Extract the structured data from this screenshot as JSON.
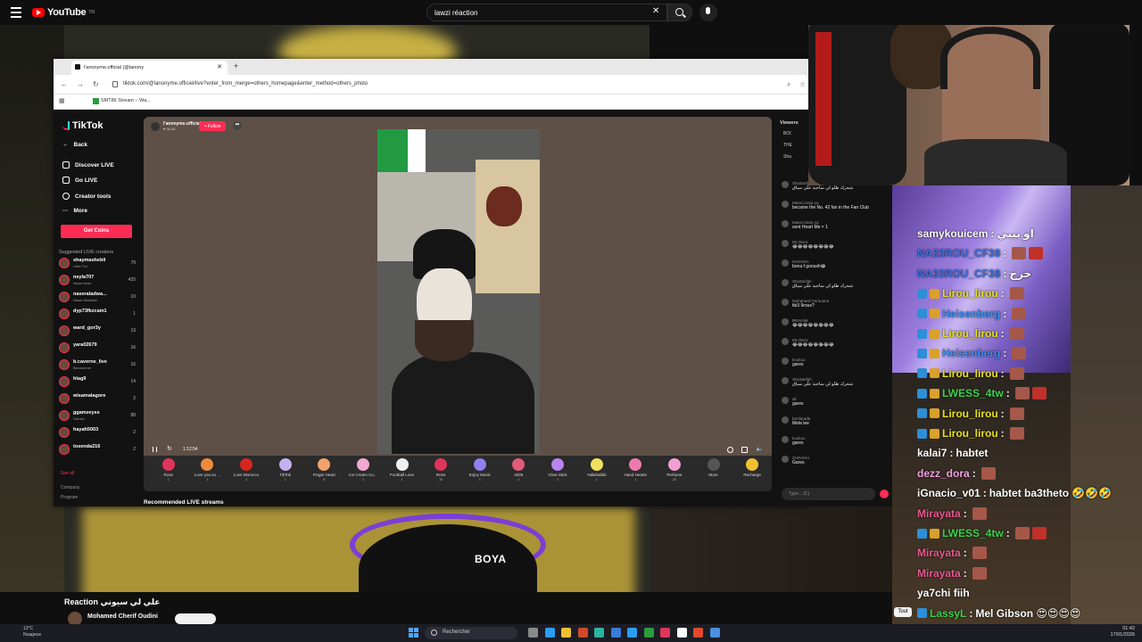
{
  "youtube": {
    "logo_text": "YouTube",
    "logo_sup": "TN",
    "search_value": "lawzi réaction",
    "video_title": "Reaction علي لي سيوني",
    "channel_name": "Mohamed Cherif Oudini",
    "tout_label": "Tout"
  },
  "browser": {
    "tab_title": "l'anonyme.official (@lanony",
    "url": "tiktok.com/@lanonyme.officiel/live?enter_from_merge=others_homepage&enter_method=others_photo",
    "bookmark": "SMT86 Stream – Wa..."
  },
  "tiktok": {
    "logo": "TikTok",
    "nav": {
      "back": "Back",
      "discover": "Discover LIVE",
      "golive": "Go LIVE",
      "creator": "Creator tools",
      "more": "More"
    },
    "get_coins": "Get Coins",
    "suggested_title": "Suggested LIVE creators",
    "creators": [
      {
        "name": "shaymashebil",
        "sub": "Little Fox",
        "count": "79"
      },
      {
        "name": "neyla707",
        "sub": "Neyla Asmr",
        "count": "425"
      },
      {
        "name": "naseraladwa...",
        "sub": "Naser Aladwan",
        "count": "10"
      },
      {
        "name": "dyp73fkzcam1",
        "sub": "",
        "count": "1"
      },
      {
        "name": "ward_gor3y",
        "sub": "",
        "count": "13"
      },
      {
        "name": "yara02679",
        "sub": "",
        "count": "16"
      },
      {
        "name": "b.caverne_live",
        "sub": "Biocaverne",
        "count": "16"
      },
      {
        "name": "hlag9",
        "sub": "",
        "count": "14"
      },
      {
        "name": "wisamalagore",
        "sub": "",
        "count": "2"
      },
      {
        "name": "ggamzeyss",
        "sub": "Gamze",
        "count": "88"
      },
      {
        "name": "hayah5003",
        "sub": "",
        "count": "2"
      },
      {
        "name": "tosenda216",
        "sub": "",
        "count": "2"
      }
    ],
    "see_all": "See all",
    "footer": [
      "Company",
      "Program"
    ],
    "host_name": "l'anonyme.official",
    "host_sub": "♥ 36.3K",
    "follow": "+ Follow",
    "time": "1:12:54",
    "gifts": [
      {
        "label": "Rose",
        "price": "1",
        "color": "#e0355a"
      },
      {
        "label": "Love you so ...",
        "price": "1",
        "color": "#f08a3c"
      },
      {
        "label": "Love Morocco",
        "price": "1",
        "color": "#d8261f"
      },
      {
        "label": "TikTok",
        "price": "1",
        "color": "#c5b0f0"
      },
      {
        "label": "Finger Heart",
        "price": "5",
        "color": "#f3a06a"
      },
      {
        "label": "Ice Cream Co...",
        "price": "1",
        "color": "#f0a8d0"
      },
      {
        "label": "Football Love",
        "price": "1",
        "color": "#eeeeee"
      },
      {
        "label": "Rose",
        "price": "10",
        "color": "#e0355a"
      },
      {
        "label": "Enjoy Music",
        "price": "1",
        "color": "#8f7ff0"
      },
      {
        "label": "2026",
        "price": "1",
        "color": "#e05a7a"
      },
      {
        "label": "Glow Stick",
        "price": "1",
        "color": "#b884f0"
      },
      {
        "label": "Yallahabibi",
        "price": "1",
        "color": "#f0e060"
      },
      {
        "label": "Hand Hearts",
        "price": "1",
        "color": "#f07ab0"
      },
      {
        "label": "Perfume",
        "price": "20",
        "color": "#f0a0d0"
      },
      {
        "label": "More",
        "price": "",
        "color": "#555555"
      },
      {
        "label": "Recharge",
        "price": "",
        "color": "#f0c030"
      }
    ],
    "recommended": "Recommended LIVE streams",
    "chat": {
      "viewers_title": "Viewers",
      "viewers": [
        "BOI",
        "THE",
        "Sha"
      ],
      "messages": [
        {
          "user": "Sha3anfgh",
          "text": "شحرك ظلو لي ساجبة علي سياق"
        },
        {
          "user": "Massi nissa ça",
          "text": "became the No. 42 fan in the Fan Club"
        },
        {
          "user": "Massi nissa ça",
          "text": "sent Heart Me × 1"
        },
        {
          "user": "Mc Renz",
          "text": "😂😂😂😂😂😂😂😂"
        },
        {
          "user": "NADARA",
          "text": "bona f gooush😂"
        },
        {
          "user": "Sha3anfgh",
          "text": "شحرك ظلو لي ساجبة علي سياق"
        },
        {
          "user": "Mohamed Ourouane",
          "text": "tbi3 9rous?"
        },
        {
          "user": "BRAHIM",
          "text": "😂😂😂😂😂😂😂😂"
        },
        {
          "user": "Mc Renz",
          "text": "😂😂😂😂😂😂😂😂"
        },
        {
          "user": "koukou",
          "text": "gares"
        },
        {
          "user": "Sha3anfgh",
          "text": "شحرك ظلو لي ساجبة علي سياق"
        },
        {
          "user": "ali",
          "text": "gares"
        },
        {
          "user": "benfarada",
          "text": "Mela lee"
        },
        {
          "user": "koukou",
          "text": "gares"
        },
        {
          "user": "ZARAKIA",
          "text": "Gares"
        }
      ],
      "input_placeholder": "Type... (C)"
    }
  },
  "twitch_chat": [
    {
      "user": "samykouicem",
      "color": "#ffffff",
      "badges": [],
      "msg": "او بيبي",
      "emotes": 0
    },
    {
      "user": "NA33ROU_CF38",
      "color": "#3b6fe0",
      "badges": [],
      "msg": "",
      "emotes": 2
    },
    {
      "user": "NA33ROU_CF38",
      "color": "#3b6fe0",
      "badges": [],
      "msg": "خرج",
      "emotes": 0
    },
    {
      "user": "Lirou_lirou",
      "color": "#e8e020",
      "badges": [
        "blue",
        "crown"
      ],
      "msg": "",
      "emotes": 1
    },
    {
      "user": "Heisenberg",
      "color": "#3b8ff0",
      "badges": [
        "blue",
        "crown"
      ],
      "msg": "",
      "emotes": 1
    },
    {
      "user": "Lirou_lirou",
      "color": "#e8e020",
      "badges": [
        "blue",
        "crown"
      ],
      "msg": "",
      "emotes": 1
    },
    {
      "user": "Heisenberg",
      "color": "#3b8ff0",
      "badges": [
        "blue",
        "crown"
      ],
      "msg": "",
      "emotes": 1
    },
    {
      "user": "Lirou_lirou",
      "color": "#e8e020",
      "badges": [
        "blue",
        "crown"
      ],
      "msg": "",
      "emotes": 1
    },
    {
      "user": "LWESS_4tw",
      "color": "#3ed04a",
      "badges": [
        "blue",
        "crown"
      ],
      "msg": "",
      "emotes": 2
    },
    {
      "user": "Lirou_lirou",
      "color": "#e8e020",
      "badges": [
        "blue",
        "crown"
      ],
      "msg": "",
      "emotes": 1
    },
    {
      "user": "Lirou_lirou",
      "color": "#e8e020",
      "badges": [
        "blue",
        "crown"
      ],
      "msg": "",
      "emotes": 1
    },
    {
      "user": "kalai7",
      "color": "#ffffff",
      "badges": [],
      "msg": "habtet",
      "emotes": 0
    },
    {
      "user": "dezz_dora",
      "color": "#f0a0e0",
      "badges": [],
      "msg": "",
      "emotes": 1
    },
    {
      "user": "iGnacio_v01",
      "color": "#ffffff",
      "badges": [],
      "msg": "habtet ba3theto 🤣🤣🤣",
      "emotes": 0
    },
    {
      "user": "Mirayata",
      "color": "#e85a90",
      "badges": [],
      "msg": "",
      "emotes": 1
    },
    {
      "user": "LWESS_4tw",
      "color": "#3ed04a",
      "badges": [
        "blue",
        "crown"
      ],
      "msg": "",
      "emotes": 2
    },
    {
      "user": "Mirayata",
      "color": "#e85a90",
      "badges": [],
      "msg": "",
      "emotes": 1
    },
    {
      "user": "Mirayata",
      "color": "#e85a90",
      "badges": [],
      "msg": "",
      "emotes": 1
    },
    {
      "user": "",
      "color": "#ffffff",
      "badges": [],
      "msg": "ya7chi fiih",
      "emotes": 0
    },
    {
      "user": "LassyL",
      "color": "#3ed04a",
      "badges": [
        "blue"
      ],
      "msg": "Mel Gibson 😍😍😍😍",
      "emotes": 0
    }
  ],
  "taskbar": {
    "weather_temp": "13°C",
    "weather_desc": "Nuageux",
    "search": "Rechercher",
    "time": "01:42",
    "date": "17/01/2026",
    "apps": [
      "#8a8a8a",
      "#2a9df4",
      "#f0c030",
      "#d04a2a",
      "#2ab4a0",
      "#3a7ad8",
      "#2a9df4",
      "#2a9d3c",
      "#e0355a",
      "#ffffff",
      "#e04a2a",
      "#4a90e2"
    ]
  }
}
